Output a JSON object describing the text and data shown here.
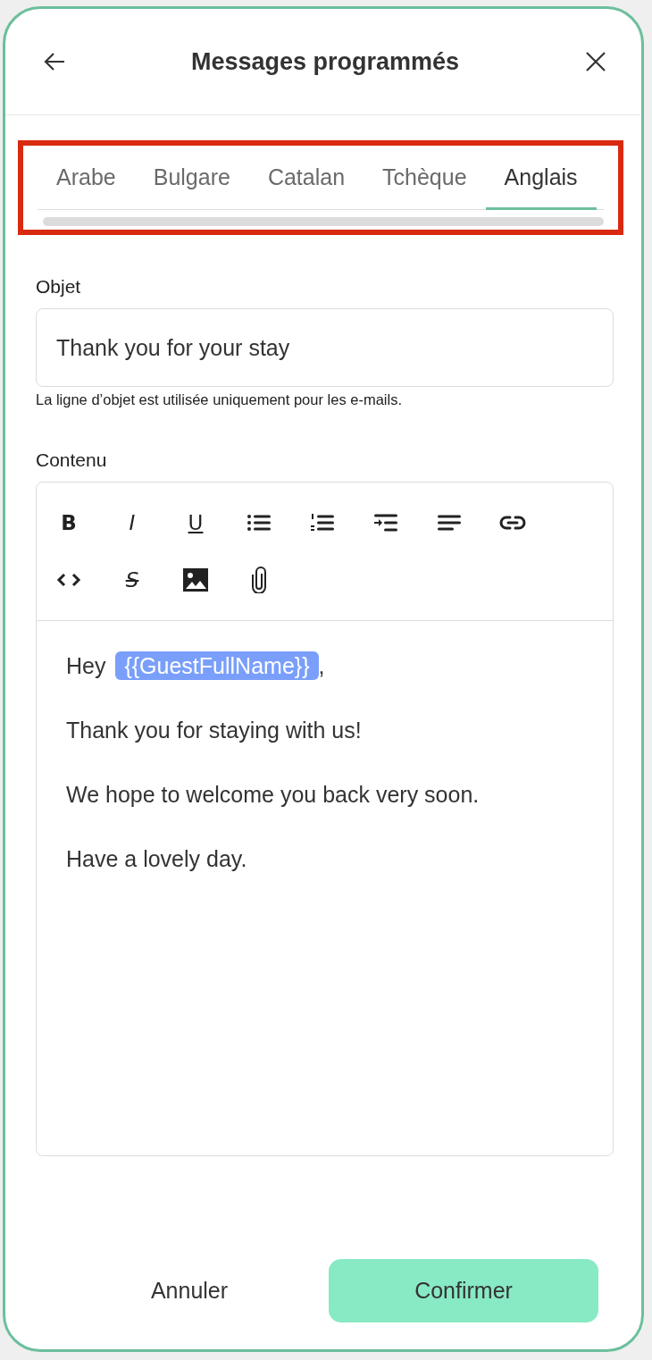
{
  "header": {
    "title": "Messages programmés"
  },
  "tabs": [
    {
      "label": "Arabe",
      "selected": false
    },
    {
      "label": "Bulgare",
      "selected": false
    },
    {
      "label": "Catalan",
      "selected": false
    },
    {
      "label": "Tchèque",
      "selected": false
    },
    {
      "label": "Anglais",
      "selected": true
    }
  ],
  "subject": {
    "label": "Objet",
    "value": "Thank you for your stay",
    "hint": "La ligne d’objet est utilisée uniquement pour les e-mails."
  },
  "content": {
    "label": "Contenu",
    "toolbar": [
      {
        "kind": "bold",
        "label": "B"
      },
      {
        "kind": "italic",
        "label": "I"
      },
      {
        "kind": "underline",
        "label": "U"
      },
      {
        "kind": "bullets"
      },
      {
        "kind": "numbers"
      },
      {
        "kind": "indent"
      },
      {
        "kind": "align"
      },
      {
        "kind": "link"
      },
      {
        "kind": "code"
      },
      {
        "kind": "strike",
        "label": "S"
      },
      {
        "kind": "image"
      },
      {
        "kind": "attach"
      }
    ],
    "first_line": {
      "before": "Hey",
      "token": "{{GuestFullName}}",
      "after": ","
    },
    "lines": [
      "Thank you for staying with us!",
      "We hope to welcome you back very soon.",
      "Have a lovely day."
    ]
  },
  "buttons": {
    "cancel": "Annuler",
    "confirm": "Confirmer"
  }
}
